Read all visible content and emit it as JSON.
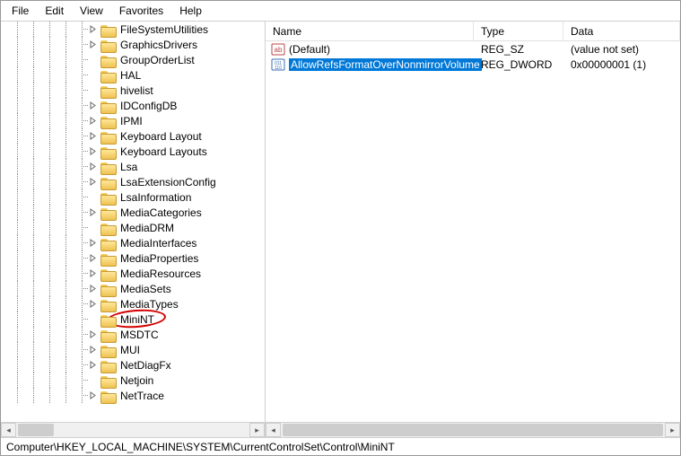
{
  "menubar": {
    "file": "File",
    "edit": "Edit",
    "view": "View",
    "favorites": "Favorites",
    "help": "Help"
  },
  "tree": {
    "items": [
      {
        "label": "FileSystemUtilities",
        "expander": "right"
      },
      {
        "label": "GraphicsDrivers",
        "expander": "right"
      },
      {
        "label": "GroupOrderList",
        "expander": "none"
      },
      {
        "label": "HAL",
        "expander": "none"
      },
      {
        "label": "hivelist",
        "expander": "none"
      },
      {
        "label": "IDConfigDB",
        "expander": "right"
      },
      {
        "label": "IPMI",
        "expander": "right"
      },
      {
        "label": "Keyboard Layout",
        "expander": "right"
      },
      {
        "label": "Keyboard Layouts",
        "expander": "right"
      },
      {
        "label": "Lsa",
        "expander": "right"
      },
      {
        "label": "LsaExtensionConfig",
        "expander": "right"
      },
      {
        "label": "LsaInformation",
        "expander": "none"
      },
      {
        "label": "MediaCategories",
        "expander": "right"
      },
      {
        "label": "MediaDRM",
        "expander": "none"
      },
      {
        "label": "MediaInterfaces",
        "expander": "right"
      },
      {
        "label": "MediaProperties",
        "expander": "right"
      },
      {
        "label": "MediaResources",
        "expander": "right"
      },
      {
        "label": "MediaSets",
        "expander": "right"
      },
      {
        "label": "MediaTypes",
        "expander": "right"
      },
      {
        "label": "MiniNT",
        "expander": "none",
        "circled": true
      },
      {
        "label": "MSDTC",
        "expander": "right"
      },
      {
        "label": "MUI",
        "expander": "right"
      },
      {
        "label": "NetDiagFx",
        "expander": "right"
      },
      {
        "label": "Netjoin",
        "expander": "none"
      },
      {
        "label": "NetTrace",
        "expander": "right"
      }
    ]
  },
  "list": {
    "columns": {
      "name": "Name",
      "type": "Type",
      "data": "Data"
    },
    "rows": [
      {
        "name": "(Default)",
        "type": "REG_SZ",
        "data": "(value not set)",
        "icon": "string",
        "selected": false
      },
      {
        "name": "AllowRefsFormatOverNonmirrorVolume",
        "type": "REG_DWORD",
        "data": "0x00000001 (1)",
        "icon": "binary",
        "selected": true
      }
    ]
  },
  "statusbar": {
    "path": "Computer\\HKEY_LOCAL_MACHINE\\SYSTEM\\CurrentControlSet\\Control\\MiniNT"
  }
}
